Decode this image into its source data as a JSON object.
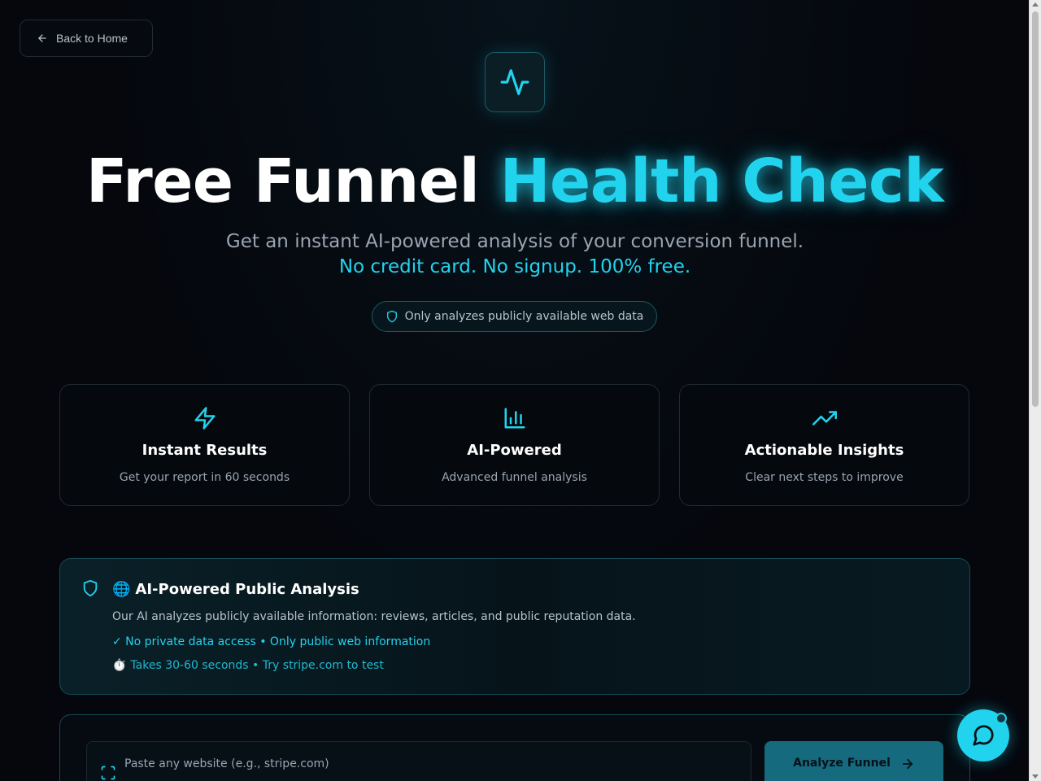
{
  "nav": {
    "back_label": "Back to Home"
  },
  "hero": {
    "title_white": "Free Funnel",
    "title_accent": "Health Check",
    "subtitle": "Get an instant AI-powered analysis of your conversion funnel.",
    "subtitle_accent": "No credit card. No signup. 100% free.",
    "pill_text": "Only analyzes publicly available web data"
  },
  "features": [
    {
      "icon": "lightning-icon",
      "title": "Instant Results",
      "desc": "Get your report in 60 seconds"
    },
    {
      "icon": "bar-chart-icon",
      "title": "AI-Powered",
      "desc": "Advanced funnel analysis"
    },
    {
      "icon": "trending-up-icon",
      "title": "Actionable Insights",
      "desc": "Clear next steps to improve"
    }
  ],
  "info": {
    "emoji": "🌐",
    "title": "AI-Powered Public Analysis",
    "desc": "Our AI analyzes publicly available information: reviews, articles, and public reputation data.",
    "line1": "✓ No private data access • Only public web information",
    "timer_emoji": "⏱️",
    "line2": "Takes 30-60 seconds • Try stripe.com to test"
  },
  "form": {
    "placeholder": "Paste any website (e.g., stripe.com)",
    "value": "",
    "button_label": "Analyze Funnel"
  },
  "colors": {
    "accent": "#22d3ee",
    "background": "#05070d",
    "button": "#156a7d"
  }
}
